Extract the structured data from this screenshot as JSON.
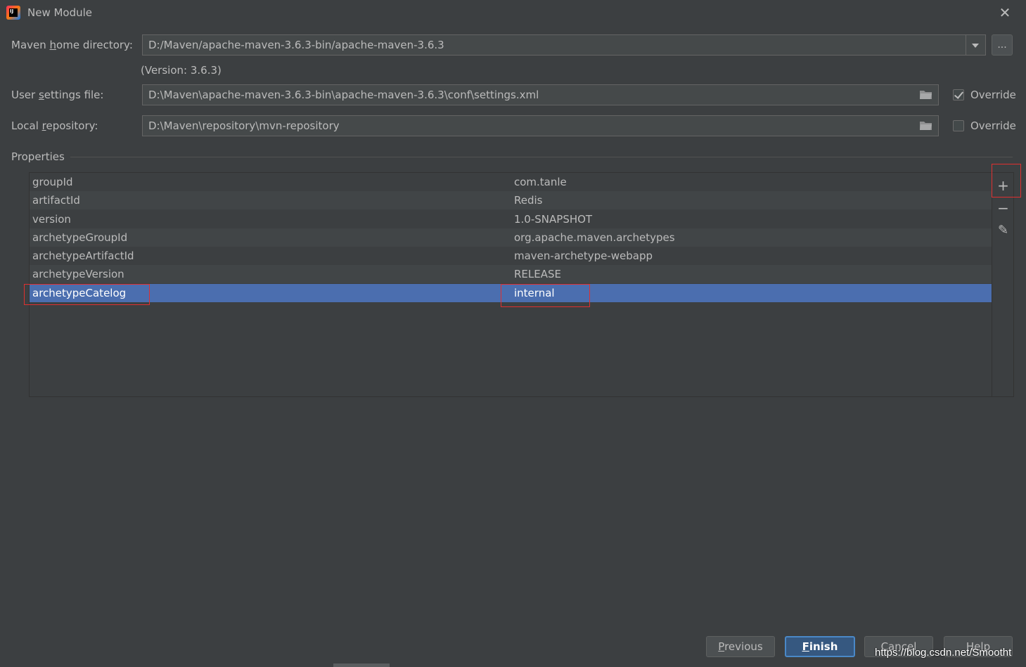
{
  "window": {
    "title": "New Module",
    "close_glyph": "✕",
    "app_icon_text": "IJ"
  },
  "maven_home": {
    "label_pre": "Maven ",
    "label_mn": "h",
    "label_post": "ome directory:",
    "value": "D:/Maven/apache-maven-3.6.3-bin/apache-maven-3.6.3",
    "browse_label": "...",
    "version_text": "(Version: 3.6.3)"
  },
  "user_settings": {
    "label_pre": "User ",
    "label_mn": "s",
    "label_post": "ettings file:",
    "value": "D:\\Maven\\apache-maven-3.6.3-bin\\apache-maven-3.6.3\\conf\\settings.xml",
    "override_label": "Override",
    "override_checked": true
  },
  "local_repo": {
    "label_pre": "Local ",
    "label_mn": "r",
    "label_post": "epository:",
    "value": "D:\\Maven\\repository\\mvn-repository",
    "override_label": "Override",
    "override_checked": false
  },
  "properties": {
    "section_label": "Properties",
    "rows": [
      {
        "key": "groupId",
        "value": "com.tanle"
      },
      {
        "key": "artifactId",
        "value": "Redis"
      },
      {
        "key": "version",
        "value": "1.0-SNAPSHOT"
      },
      {
        "key": "archetypeGroupId",
        "value": "org.apache.maven.archetypes"
      },
      {
        "key": "archetypeArtifactId",
        "value": "maven-archetype-webapp"
      },
      {
        "key": "archetypeVersion",
        "value": "RELEASE"
      },
      {
        "key": "archetypeCatelog",
        "value": "internal"
      }
    ],
    "selected_index": 6,
    "tools": {
      "add": "+",
      "remove": "−",
      "edit": "✎"
    }
  },
  "buttons": {
    "previous_mn": "P",
    "previous_rest": "revious",
    "finish_mn": "F",
    "finish_rest": "inish",
    "cancel": "Cancel",
    "help": "Help"
  },
  "watermark": "https://blog.csdn.net/Smootht",
  "colors": {
    "background": "#3c3f41",
    "selection": "#4b6eaf",
    "highlight_box": "#e03030",
    "primary_button": "#365880"
  }
}
